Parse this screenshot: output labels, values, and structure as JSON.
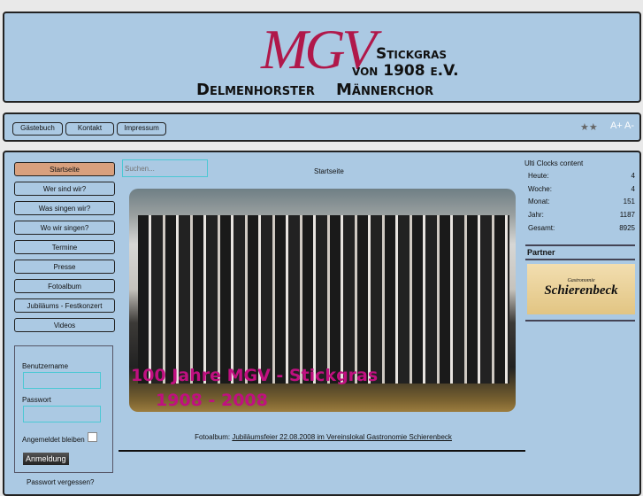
{
  "logo": {
    "mgv": "MGV",
    "line1": "Stickgras",
    "line2": "von 1908 e.V.",
    "line3a": "Delmenhorster",
    "line3b": "Männerchor"
  },
  "nav": {
    "links": [
      "Gästebuch",
      "Kontakt",
      "Impressum"
    ],
    "font_plus": "A+",
    "font_minus": "A-"
  },
  "menu": [
    "Startseite",
    "Wer sind wir?",
    "Was singen wir?",
    "Wo wir singen?",
    "Termine",
    "Presse",
    "Fotoalbum",
    "Jubiläums - Festkonzert",
    "Videos"
  ],
  "search": {
    "placeholder": "Suchen..."
  },
  "main": {
    "title": "Startseite",
    "photo_line1": "100 Jahre MGV - Stickgras",
    "photo_line2": "1908 - 2008",
    "caption_label": "Fotoalbum:",
    "caption_link": "Jubiläumsfeier 22.08.2008 im Vereinslokal Gastronomie Schierenbeck"
  },
  "login": {
    "username_label": "Benutzername",
    "password_label": "Passwort",
    "remember_label": "Angemeldet bleiben",
    "submit": "Anmeldung",
    "forgot": "Passwort vergessen?"
  },
  "stats": {
    "title": "Ulti Clocks content",
    "rows": [
      {
        "label": "Heute:",
        "value": "4"
      },
      {
        "label": "Woche:",
        "value": "4"
      },
      {
        "label": "Monat:",
        "value": "151"
      },
      {
        "label": "Jahr:",
        "value": "1187"
      },
      {
        "label": "Gesamt:",
        "value": "8925"
      }
    ]
  },
  "partner": {
    "title": "Partner",
    "logo_small": "Gastronomie",
    "logo_big": "Schierenbeck"
  }
}
